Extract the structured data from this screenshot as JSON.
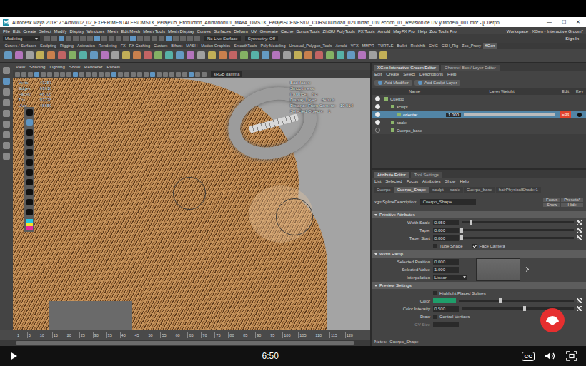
{
  "player": {
    "time": "6:50",
    "captions_label": "CC",
    "playing": false
  },
  "maya": {
    "title": "Autodesk Maya 2018: Z:\\Activo\\02_02_EXPERIMENTALES\\DMSTK_Pelaje\\05_Production_Animation\\01_MAYA_DMSTK_Pelaje\\SCENES\\07_CURSO\\Unidad_02\\Unidad_01\\Leccion_01_Revision de UV y Modelo_001.mb* - [Cuerpo",
    "window_controls": [
      "—",
      "☐",
      "✕"
    ],
    "menu": [
      "File",
      "Edit",
      "Create",
      "Select",
      "Modify",
      "Display",
      "Windows",
      "Mesh",
      "Edit Mesh",
      "Mesh Tools",
      "Mesh Display",
      "Curves",
      "Surfaces",
      "Deform",
      "UV",
      "Generate",
      "Cache",
      "Bonus Tools",
      "ZhiGU PolyTools",
      "FX Tools",
      "Arnold",
      "MayFX Pro",
      "Help",
      "Zoo Tools Pro"
    ],
    "workspace": "Workspace : XGen - Interactive Groom*",
    "status_line": {
      "mode": "Modeling",
      "live_surface": "No Live Surface",
      "symmetry": "Symmetry: Off",
      "sign_in": "Sign In"
    },
    "shelf_tabs": [
      {
        "label": "Curves / Surfaces",
        "selected": false
      },
      {
        "label": "Sculpting",
        "selected": false
      },
      {
        "label": "Rigging",
        "selected": false
      },
      {
        "label": "Animation",
        "selected": false
      },
      {
        "label": "Rendering",
        "selected": false
      },
      {
        "label": "FX",
        "selected": false
      },
      {
        "label": "FX Caching",
        "selected": false
      },
      {
        "label": "Custom",
        "selected": false
      },
      {
        "label": "Bifrost",
        "selected": false
      },
      {
        "label": "MASH",
        "selected": false
      },
      {
        "label": "Motion Graphics",
        "selected": false
      },
      {
        "label": "SmoothTools",
        "selected": false
      },
      {
        "label": "Poly Modeling",
        "selected": false
      },
      {
        "label": "Unusual_Polygon_Tools",
        "selected": false
      },
      {
        "label": "Arnold",
        "selected": false
      },
      {
        "label": "VFX",
        "selected": false
      },
      {
        "label": "MMPR",
        "selected": false
      },
      {
        "label": "TURTLE",
        "selected": false
      },
      {
        "label": "Bullet",
        "selected": false
      },
      {
        "label": "Redshift",
        "selected": false
      },
      {
        "label": "ChIC",
        "selected": false
      },
      {
        "label": "CSH_Rig",
        "selected": false
      },
      {
        "label": "Zoo_Proxy",
        "selected": false
      },
      {
        "label": "XGen",
        "selected": true
      }
    ],
    "viewport": {
      "menu": [
        "View",
        "Shading",
        "Lighting",
        "Show",
        "Renderer",
        "Panels"
      ],
      "gamma": "sRGB gamma",
      "hud_left": [
        {
          "label": "Verts:",
          "value": "47257"
        },
        {
          "label": "Edges:",
          "value": "93616"
        },
        {
          "label": "Faces:",
          "value": "46706"
        },
        {
          "label": "Tris:",
          "value": "93228"
        },
        {
          "label": "UVs:",
          "value": "48659"
        }
      ],
      "hud_right": [
        {
          "label": "Backfaces:",
          "value": ""
        },
        {
          "label": "Smoothness:",
          "value": ""
        },
        {
          "label": "Instance:",
          "value": "No"
        },
        {
          "label": "Display Layer:",
          "value": "default"
        },
        {
          "label": "Distance From Camera:",
          "value": "10.914"
        },
        {
          "label": "Selected Objects:",
          "value": "1"
        }
      ]
    },
    "timeline_ticks": [
      "1",
      "5",
      "10",
      "15",
      "20",
      "25",
      "30",
      "35",
      "40",
      "45",
      "50",
      "55",
      "60",
      "65",
      "70",
      "75",
      "80",
      "85",
      "90",
      "95",
      "100",
      "105",
      "110",
      "115",
      "120"
    ],
    "xgen": {
      "tabs": [
        {
          "label": "XGen Interactive Groom Editor",
          "selected": true
        },
        {
          "label": "Channel Box / Layer Editor",
          "selected": false
        }
      ],
      "menu": [
        "Edit",
        "Create",
        "Select",
        "Descriptions",
        "Help"
      ],
      "buttons": [
        "Add Modifier",
        "Add Sculpt Layer"
      ],
      "columns": [
        "Name",
        "Layer Weight",
        "Edit",
        "Key"
      ],
      "layers": [
        {
          "name": "Cuerpo",
          "depth": 0,
          "visible": true,
          "selected": false,
          "keyed": false
        },
        {
          "name": "sculpt",
          "depth": 1,
          "visible": true,
          "selected": false,
          "keyed": false
        },
        {
          "name": "orientar",
          "depth": 2,
          "visible": true,
          "selected": true,
          "keyed": true,
          "weight": "1.000",
          "level": 1.0,
          "edit": "Edit"
        },
        {
          "name": "scale",
          "depth": 1,
          "visible": true,
          "selected": false,
          "keyed": false
        },
        {
          "name": "Cuerpo_base",
          "depth": 1,
          "visible": false,
          "selected": false,
          "keyed": false
        }
      ]
    },
    "attribute_editor": {
      "tabs": [
        {
          "label": "Attribute Editor",
          "selected": true
        },
        {
          "label": "Tool Settings",
          "selected": false
        }
      ],
      "menu": [
        "List",
        "Selected",
        "Focus",
        "Attributes",
        "Show",
        "Help"
      ],
      "node_tabs": [
        {
          "label": "Cuerpo",
          "selected": false
        },
        {
          "label": "Cuerpo_Shape",
          "selected": true
        },
        {
          "label": "sculpt",
          "selected": false
        },
        {
          "label": "scale",
          "selected": false
        },
        {
          "label": "Cuerpo_base",
          "selected": false
        },
        {
          "label": "hairPhysicalShader1",
          "selected": false
        }
      ],
      "description_label": "xgmSplineDescription:",
      "description_value": "Cuerpo_Shape",
      "description_buttons": [
        "Focus",
        "Presets*",
        "Show",
        "Hide"
      ],
      "sections": [
        {
          "title": "Primitive Attributes",
          "expanded": true,
          "rows": [
            {
              "kind": "slider",
              "label": "Width Scale",
              "value": "0.050",
              "level": 0.08,
              "disabled": false
            },
            {
              "kind": "slider",
              "label": "Taper",
              "value": "0.000",
              "level": 0.0,
              "disabled": false
            },
            {
              "kind": "slider",
              "label": "Taper Start",
              "value": "0.000",
              "level": 0.0,
              "disabled": false
            },
            {
              "kind": "checks",
              "label": "",
              "items": [
                {
                  "label": "Tube Shade",
                  "checked": false
                },
                {
                  "label": "Face Camera",
                  "checked": true
                }
              ]
            }
          ]
        },
        {
          "title": "Width Ramp",
          "expanded": true,
          "rows": [
            {
              "kind": "field",
              "label": "Selected Position",
              "value": "0.000",
              "disabled": false
            },
            {
              "kind": "field",
              "label": "Selected Value",
              "value": "1.000",
              "disabled": false
            },
            {
              "kind": "dropdown",
              "label": "Interpolation",
              "value": "Linear"
            }
          ]
        },
        {
          "title": "Preview Settings",
          "expanded": true,
          "rows": [
            {
              "kind": "checks",
              "label": "",
              "items": [
                {
                  "label": "Highlight Placed Splines",
                  "checked": false
                }
              ]
            },
            {
              "kind": "color",
              "label": "Color",
              "color": "#1f9e6a",
              "level": 0.36
            },
            {
              "kind": "slider",
              "label": "Color Intensity",
              "value": "0.500",
              "level": 0.56,
              "disabled": false
            },
            {
              "kind": "checks",
              "label": "Draw",
              "items": [
                {
                  "label": "Control Vertices",
                  "checked": false
                }
              ]
            },
            {
              "kind": "field",
              "label": "CV Size",
              "value": "",
              "disabled": true
            }
          ]
        }
      ],
      "notes_label": "Notes:",
      "notes_value": "Cuerpo_Shape"
    }
  }
}
